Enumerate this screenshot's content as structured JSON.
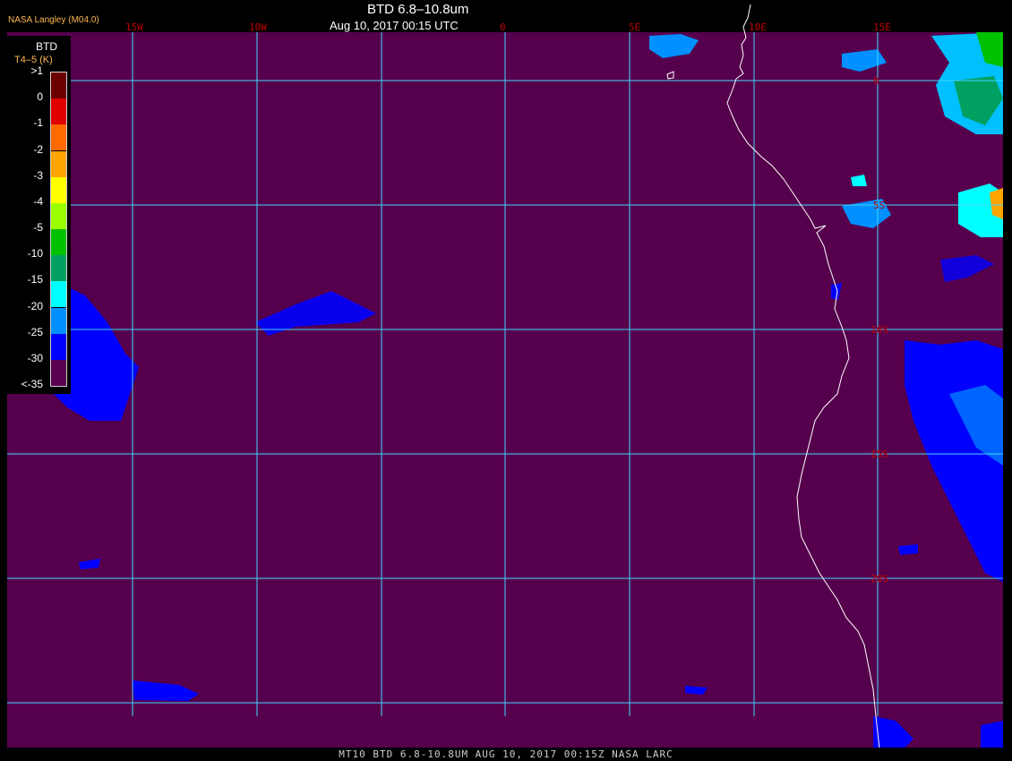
{
  "header": {
    "credit": "NASA Langley (M04.0)",
    "title": "BTD 6.8–10.8um",
    "subtitle": "Aug 10, 2017 00:15 UTC"
  },
  "legend": {
    "title": "BTD",
    "subtitle": "T4–5 (K)",
    "ticks": [
      ">1",
      "0",
      "-1",
      "-2",
      "-3",
      "-4",
      "-5",
      "-10",
      "-15",
      "-20",
      "-25",
      "-30",
      "<-35"
    ],
    "colors": [
      "#6b0000",
      "#e00000",
      "#ff6a00",
      "#ffa500",
      "#ffff00",
      "#9aff00",
      "#00c000",
      "#00a060",
      "#00ffff",
      "#0090ff",
      "#0000ff",
      "#5a0050"
    ]
  },
  "map": {
    "background_color": "#56004d",
    "grid_color": "#40d8ff",
    "coast_color": "#ffffff",
    "longitude_labels": [
      "15W",
      "10W",
      "0",
      "5E",
      "10E",
      "15E"
    ],
    "latitude_labels": [
      "0",
      "5S",
      "10S",
      "15S",
      "20S"
    ]
  },
  "footer": {
    "text": "MT10  BTD 6.8-10.8UM   AUG 10, 2017 00:15Z   NASA LARC"
  }
}
